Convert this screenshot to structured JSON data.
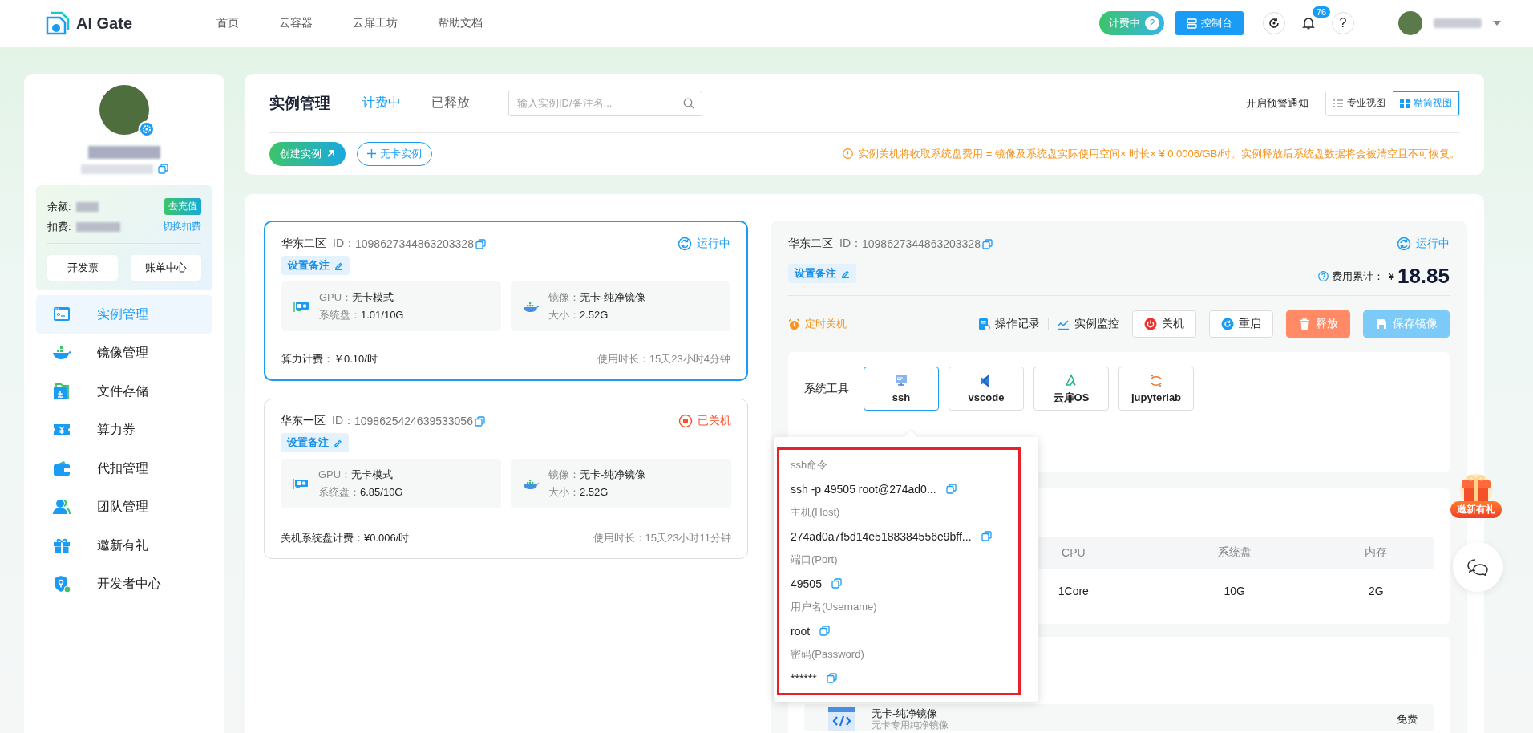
{
  "header": {
    "logo": "AI Gate",
    "nav": [
      {
        "label": "首页"
      },
      {
        "label": "云容器"
      },
      {
        "label": "云扉工坊"
      },
      {
        "label": "帮助文档"
      }
    ],
    "billing": {
      "label": "计费中",
      "count": "2"
    },
    "console": "控制台",
    "notifications": "76",
    "help": "?"
  },
  "sidebar": {
    "balance_label": "余额:",
    "recharge": "去充值",
    "deduct_label": "扣费:",
    "switch_deduct": "切换扣费",
    "buttons": [
      "开发票",
      "账单中心"
    ],
    "items": [
      {
        "label": "实例管理",
        "kind": "terminal",
        "selected": true
      },
      {
        "label": "镜像管理",
        "kind": "docker",
        "selected": false
      },
      {
        "label": "文件存储",
        "kind": "folder",
        "selected": false
      },
      {
        "label": "算力券",
        "kind": "coupon",
        "selected": false
      },
      {
        "label": "代扣管理",
        "kind": "wallet",
        "selected": false
      },
      {
        "label": "团队管理",
        "kind": "team",
        "selected": false
      },
      {
        "label": "邀新有礼",
        "kind": "gift",
        "selected": false
      },
      {
        "label": "开发者中心",
        "kind": "shield",
        "selected": false
      }
    ]
  },
  "toolbar": {
    "title": "实例管理",
    "tabs": [
      {
        "label": "计费中",
        "selected": true
      },
      {
        "label": "已释放",
        "selected": false
      }
    ],
    "search": {
      "placeholder": "输入实例ID/备注名..."
    },
    "alert_toggle": "开启预警通知",
    "views": [
      {
        "label": "专业视图",
        "kind": "list",
        "selected": false
      },
      {
        "label": "精简视图",
        "kind": "grid",
        "selected": true
      }
    ],
    "create_button": "创建实例",
    "no_card_button": "无卡实例",
    "notice": "实例关机将收取系统盘费用 = 镜像及系统盘实际使用空间× 时长× ¥ 0.0006/GB/时。实例释放后系统盘数据将会被清空且不可恢复。"
  },
  "instances": [
    {
      "region": "华东二区",
      "id_label": "ID：",
      "id": "1098627344863203328",
      "status": "运行中",
      "kind": "running",
      "selected": true,
      "remark": "设置备注",
      "gpu_label": "GPU：",
      "gpu": "无卡模式",
      "disk_label": "系统盘：",
      "disk": "1.01/10G",
      "image_label": "镜像：",
      "image": "无卡-纯净镜像",
      "size_label": "大小：",
      "size": "2.52G",
      "fee": "算力计费：￥0.10/时",
      "duration": "使用时长：15天23小时4分钟"
    },
    {
      "region": "华东一区",
      "id_label": "ID：",
      "id": "1098625424639533056",
      "status": "已关机",
      "kind": "stopped",
      "selected": false,
      "remark": "设置备注",
      "gpu_label": "GPU：",
      "gpu": "无卡模式",
      "disk_label": "系统盘：",
      "disk": "6.85/10G",
      "image_label": "镜像：",
      "image": "无卡-纯净镜像",
      "size_label": "大小：",
      "size": "2.52G",
      "fee": "关机系统盘计费：¥0.006/时",
      "duration": "使用时长：15天23小时11分钟"
    }
  ],
  "detail": {
    "region": "华东二区",
    "id_label": "ID：",
    "id": "1098627344863203328",
    "status": "运行中",
    "kind": "running",
    "remark": "设置备注",
    "cost_label": "费用累计：",
    "currency": "¥",
    "cost": "18.85",
    "timer": "定时关机",
    "links": [
      {
        "label": "操作记录",
        "kind": "log"
      },
      {
        "label": "实例监控",
        "kind": "monitor"
      }
    ],
    "actions": [
      {
        "label": "关机",
        "kind": "power"
      },
      {
        "label": "重启",
        "kind": "restart"
      },
      {
        "label": "释放",
        "kind": "release"
      },
      {
        "label": "保存镜像",
        "kind": "save"
      }
    ],
    "tools_label": "系统工具",
    "tools": [
      {
        "label": "ssh",
        "kind": "ssh",
        "selected": true
      },
      {
        "label": "vscode",
        "kind": "vscode",
        "selected": false
      },
      {
        "label": "云扉OS",
        "kind": "os",
        "selected": false
      },
      {
        "label": "jupyterlab",
        "kind": "jupyter",
        "selected": false
      }
    ],
    "ssh_popup": [
      {
        "label": "ssh命令",
        "value": "ssh -p 49505 root@274ad0..."
      },
      {
        "label": "主机(Host)",
        "value": "274ad0a7f5d14e5188384556e9bff..."
      },
      {
        "label": "端口(Port)",
        "value": "49505"
      },
      {
        "label": "用户名(Username)",
        "value": "root"
      },
      {
        "label": "密码(Password)",
        "value": "******"
      }
    ],
    "spec_table": {
      "columns": [
        "CPU",
        "系统盘",
        "内存"
      ],
      "rows": [
        [
          "1Core",
          "10G",
          "2G"
        ]
      ]
    },
    "image": {
      "name": "无卡-纯净镜像",
      "description": "无卡专用纯净镜像",
      "price": "免费"
    }
  },
  "floating": {
    "invite": "邀新有礼"
  }
}
